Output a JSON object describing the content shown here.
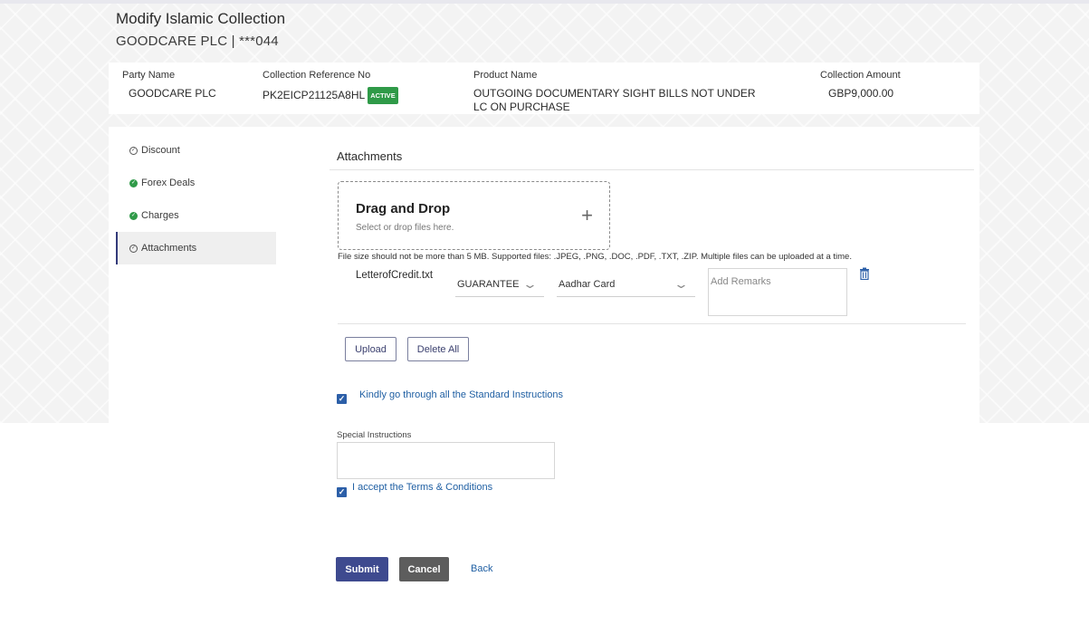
{
  "header": {
    "title": "Modify Islamic Collection",
    "subtitle": "GOODCARE PLC | ***044"
  },
  "summary": {
    "party_name_label": "Party Name",
    "party_name_value": "GOODCARE PLC",
    "collection_ref_label": "Collection Reference No",
    "collection_ref_value": "PK2EICP21125A8HL",
    "status_badge": "ACTIVE",
    "product_name_label": "Product Name",
    "product_name_value_line1": "OUTGOING DOCUMENTARY SIGHT BILLS NOT UNDER",
    "product_name_value_line2": "LC ON PURCHASE",
    "collection_amount_label": "Collection Amount",
    "collection_amount_value": "GBP9,000.00"
  },
  "sidebar": {
    "items": [
      {
        "label": "Discount",
        "status": "pending-icon"
      },
      {
        "label": "Forex Deals",
        "status": "completed-icon"
      },
      {
        "label": "Charges",
        "status": "completed-icon"
      },
      {
        "label": "Attachments",
        "status": "pending-icon"
      }
    ]
  },
  "attachments": {
    "section_title": "Attachments",
    "dropzone_title": "Drag and Drop",
    "dropzone_subtitle": "Select or drop files here.",
    "plus_symbol": "+",
    "file_note": "File size should not be more than 5 MB. Supported files: .JPEG, .PNG, .DOC, .PDF, .TXT, .ZIP. Multiple files can be uploaded at a time.",
    "file": {
      "name": "LetterofCredit.txt",
      "document_category": "GUARANTEE",
      "document_type": "Aadhar Card",
      "remarks_placeholder": "Add Remarks"
    },
    "upload_label": "Upload",
    "delete_all_label": "Delete All"
  },
  "instructions": {
    "standard_label": "Kindly go through all the Standard Instructions",
    "standard_checked": true,
    "special_label": "Special Instructions",
    "special_value": "",
    "terms_label": "I accept the Terms & Conditions",
    "terms_checked": true
  },
  "actions": {
    "submit_label": "Submit",
    "cancel_label": "Cancel",
    "back_label": "Back"
  },
  "colors": {
    "primary": "#3e4a8f",
    "success": "#2f9a48",
    "link": "#1f5fa3",
    "cancel": "#5d5d5d"
  }
}
